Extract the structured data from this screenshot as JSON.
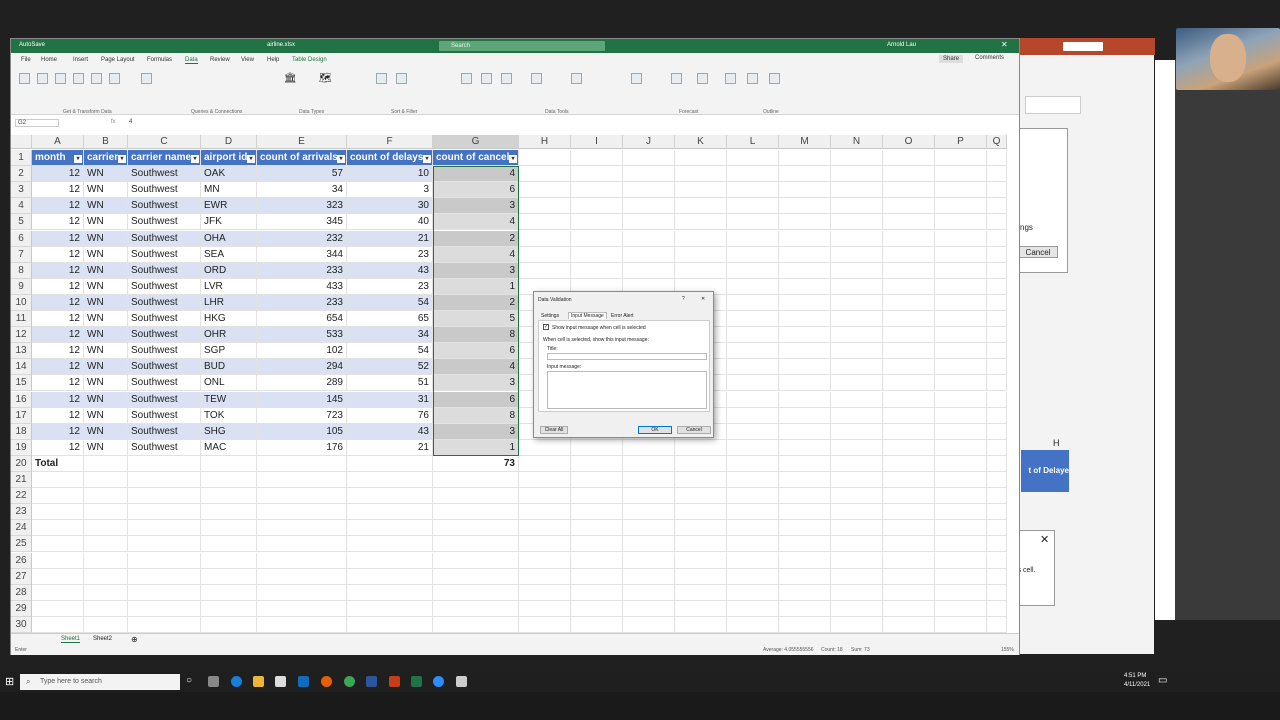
{
  "excel": {
    "title": {
      "autosave": "AutoSave",
      "filename": "airline.xlsx",
      "search_placeholder": "Search",
      "user": "Arnold Lau"
    },
    "menu": [
      "File",
      "Home",
      "Insert",
      "Page Layout",
      "Formulas",
      "Data",
      "Review",
      "View",
      "Help",
      "Table Design"
    ],
    "share_label": "Share",
    "comments_label": "Comments",
    "ribbon_groups": [
      "Get & Transform Data",
      "Queries & Connections",
      "Data Types",
      "Sort & Filter",
      "Data Tools",
      "Forecast",
      "Outline"
    ],
    "name_box": "G2",
    "formula_value": "4",
    "columns": [
      "A",
      "B",
      "C",
      "D",
      "E",
      "F",
      "G",
      "H",
      "I",
      "J",
      "K",
      "L",
      "M",
      "N",
      "O",
      "P",
      "Q"
    ],
    "headers": [
      "month",
      "carrier",
      "carrier name",
      "airport id",
      "count of arrivals",
      "count of delays",
      "count of cancel"
    ],
    "rows": [
      [
        "12",
        "WN",
        "Southwest",
        "OAK",
        "57",
        "10",
        "4"
      ],
      [
        "12",
        "WN",
        "Southwest",
        "MN",
        "34",
        "3",
        "6"
      ],
      [
        "12",
        "WN",
        "Southwest",
        "EWR",
        "323",
        "30",
        "3"
      ],
      [
        "12",
        "WN",
        "Southwest",
        "JFK",
        "345",
        "40",
        "4"
      ],
      [
        "12",
        "WN",
        "Southwest",
        "OHA",
        "232",
        "21",
        "2"
      ],
      [
        "12",
        "WN",
        "Southwest",
        "SEA",
        "344",
        "23",
        "4"
      ],
      [
        "12",
        "WN",
        "Southwest",
        "ORD",
        "233",
        "43",
        "3"
      ],
      [
        "12",
        "WN",
        "Southwest",
        "LVR",
        "433",
        "23",
        "1"
      ],
      [
        "12",
        "WN",
        "Southwest",
        "LHR",
        "233",
        "54",
        "2"
      ],
      [
        "12",
        "WN",
        "Southwest",
        "HKG",
        "654",
        "65",
        "5"
      ],
      [
        "12",
        "WN",
        "Southwest",
        "OHR",
        "533",
        "34",
        "8"
      ],
      [
        "12",
        "WN",
        "Southwest",
        "SGP",
        "102",
        "54",
        "6"
      ],
      [
        "12",
        "WN",
        "Southwest",
        "BUD",
        "294",
        "52",
        "4"
      ],
      [
        "12",
        "WN",
        "Southwest",
        "ONL",
        "289",
        "51",
        "3"
      ],
      [
        "12",
        "WN",
        "Southwest",
        "TEW",
        "145",
        "31",
        "6"
      ],
      [
        "12",
        "WN",
        "Southwest",
        "TOK",
        "723",
        "76",
        "8"
      ],
      [
        "12",
        "WN",
        "Southwest",
        "SHG",
        "105",
        "43",
        "3"
      ],
      [
        "12",
        "WN",
        "Southwest",
        "MAC",
        "176",
        "21",
        "1"
      ]
    ],
    "total_label": "Total",
    "total_value": "73",
    "sheet_tabs": [
      "Sheet1",
      "Sheet2"
    ],
    "status": {
      "mode": "Enter",
      "average": "Average: 4.055555556",
      "count": "Count: 18",
      "sum": "Sum: 73",
      "zoom": "155%"
    }
  },
  "dialog": {
    "title": "Data Validation",
    "tabs": [
      "Settings",
      "Input Message",
      "Error Alert"
    ],
    "checkbox_label": "Show input message when cell is selected",
    "instruction": "When cell is selected, show this input message:",
    "title_label": "Title:",
    "message_label": "Input message:",
    "clear_all": "Clear All",
    "ok": "OK",
    "cancel": "Cancel"
  },
  "background_window": {
    "fragment_settings": "tings",
    "cancel": "Cancel",
    "col_h": "H",
    "delayed": "t of Delaye",
    "cell_text": "is cell."
  },
  "taskbar": {
    "search_placeholder": "Type here to search",
    "time": "4:51 PM",
    "date": "4/11/2021"
  }
}
